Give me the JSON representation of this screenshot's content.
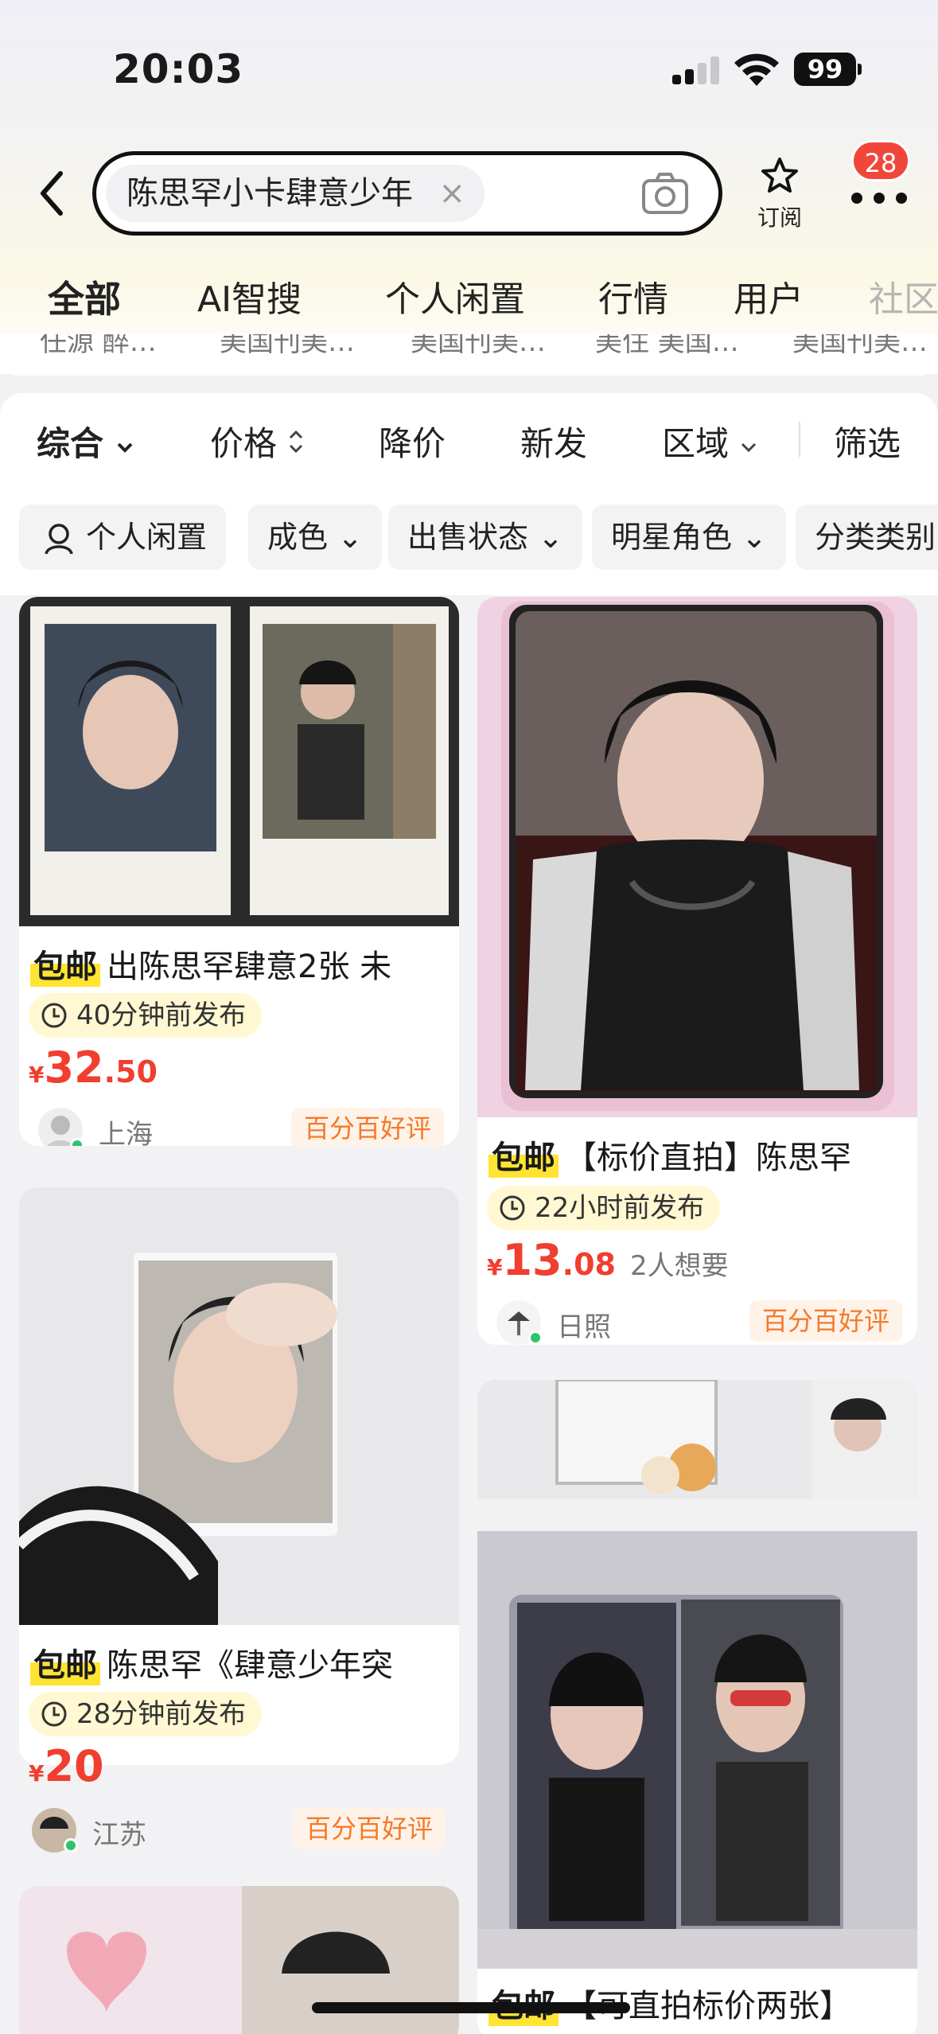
{
  "status_bar": {
    "time": "20:03",
    "battery": "99"
  },
  "search": {
    "query": "陈思罕小卡肆意少年",
    "clear_glyph": "×"
  },
  "subscribe_label": "订阅",
  "notification_badge": "28",
  "tabs": [
    "全部",
    "AI智搜",
    "个人闲置",
    "行情",
    "用户",
    "社区"
  ],
  "peek_strip": [
    "任源 醉…",
    "美国刊美…",
    "美国刊美…",
    "美住 美国…",
    "美国刊美…"
  ],
  "filters": [
    "综合",
    "价格",
    "降价",
    "新发",
    "区域",
    "筛选"
  ],
  "chips": [
    "个人闲置",
    "成色",
    "出售状态",
    "明星角色",
    "分类类别"
  ],
  "items": [
    {
      "tag": "包邮",
      "title": "出陈思罕肆意2张 未",
      "time": "40分钟前发布",
      "price_symbol": "¥",
      "price_int": "32",
      "price_dec": ".50",
      "want": "",
      "location": "上海",
      "rating": "百分百好评"
    },
    {
      "tag": "包邮",
      "title": "【标价直拍】陈思罕",
      "time": "22小时前发布",
      "price_symbol": "¥",
      "price_int": "13",
      "price_dec": ".08",
      "want": "2人想要",
      "location": "日照",
      "rating": "百分百好评"
    },
    {
      "tag": "包邮",
      "title": "陈思罕《肆意少年突",
      "time": "28分钟前发布",
      "price_symbol": "¥",
      "price_int": "20",
      "price_dec": "",
      "want": "",
      "location": "江苏",
      "rating": "百分百好评"
    },
    {
      "tag": "包邮",
      "title": "【可直拍标价两张】"
    }
  ],
  "colors": {
    "accent_yellow": "#ffe433",
    "price_red": "#f03e2f",
    "rating_orange": "#f37a2a",
    "badge_red": "#f1473b"
  }
}
